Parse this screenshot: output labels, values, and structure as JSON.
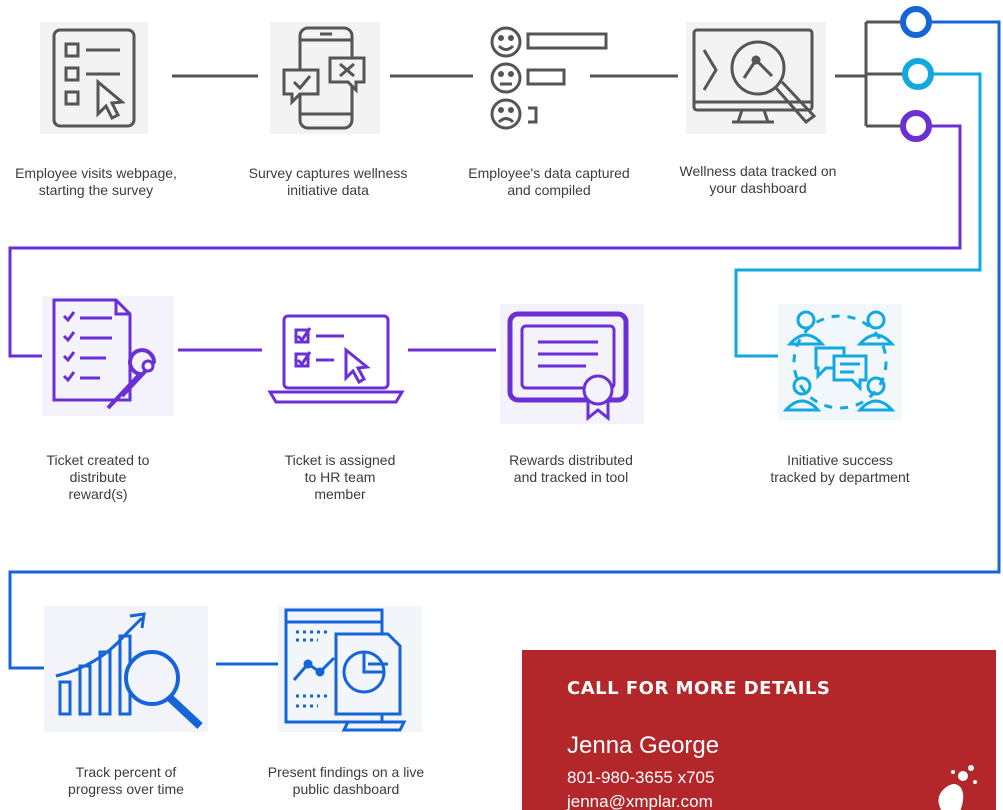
{
  "colors": {
    "gray": "#555555",
    "purple": "#6b2fd6",
    "blue": "#1565d8",
    "cyan": "#12a8e0",
    "cta_bg": "#b3272a",
    "text": "#3c3c3c"
  },
  "steps": [
    {
      "icon": "survey-checklist-icon",
      "label": "Employee visits webpage,\nstarting the survey"
    },
    {
      "icon": "phone-survey-icon",
      "label": "Survey captures wellness\ninitiative data"
    },
    {
      "icon": "emotion-ratings-icon",
      "label": "Employee's data captured\nand compiled"
    },
    {
      "icon": "dashboard-analytics-icon",
      "label": "Wellness data tracked on\nyour dashboard"
    },
    {
      "icon": "ticket-tools-icon",
      "label": "Ticket created to\ndistribute\nreward(s)"
    },
    {
      "icon": "laptop-assign-icon",
      "label": "Ticket is assigned\nto HR team\nmember"
    },
    {
      "icon": "certificate-award-icon",
      "label": "Rewards distributed\nand tracked in tool"
    },
    {
      "icon": "team-chat-icon",
      "label": "Initiative success\ntracked by department"
    },
    {
      "icon": "growth-chart-icon",
      "label": "Track percent of\nprogress over time"
    },
    {
      "icon": "public-dashboard-icon",
      "label": "Present findings on a live\npublic dashboard"
    }
  ],
  "cta": {
    "heading": "CALL FOR MORE DETAILS",
    "name": "Jenna George",
    "phone": "801-980-3655 x705",
    "email": "jenna@xmplar.com"
  }
}
